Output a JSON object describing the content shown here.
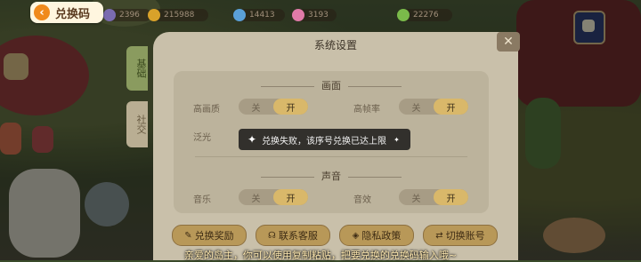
{
  "back_button": {
    "label": "兑换码"
  },
  "resources": [
    {
      "value": "2396",
      "color": "#7a6bb0"
    },
    {
      "value": "215988",
      "color": "#d8a22a"
    },
    {
      "value": "14413",
      "color": "#5aa0d8"
    },
    {
      "value": "3193",
      "color": "#e07aa8"
    },
    {
      "value": "22276",
      "color": "#7aba4a"
    }
  ],
  "dialog": {
    "title": "系统设置",
    "close": "✕",
    "tabs": [
      "基础",
      "社交"
    ],
    "sections": {
      "display": {
        "title": "画面",
        "rows": [
          {
            "label": "高画质",
            "off": "关",
            "on": "开"
          },
          {
            "label": "高帧率",
            "off": "关",
            "on": "开"
          }
        ],
        "partial_label": "泛光"
      },
      "sound": {
        "title": "声音",
        "rows": [
          {
            "label": "音乐",
            "off": "关",
            "on": "开"
          },
          {
            "label": "音效",
            "off": "关",
            "on": "开"
          }
        ]
      }
    },
    "buttons": [
      {
        "label": "兑换奖励",
        "icon": "pencil-icon"
      },
      {
        "label": "联系客服",
        "icon": "headset-icon"
      },
      {
        "label": "隐私政策",
        "icon": "shield-icon"
      },
      {
        "label": "切换账号",
        "icon": "swap-icon"
      }
    ]
  },
  "toast": {
    "text": "兑换失败，该序号兑换已达上限"
  },
  "hint": "亲爱的岛主，你可以使用复制粘贴，把要兑换的兑换码输入哦~"
}
